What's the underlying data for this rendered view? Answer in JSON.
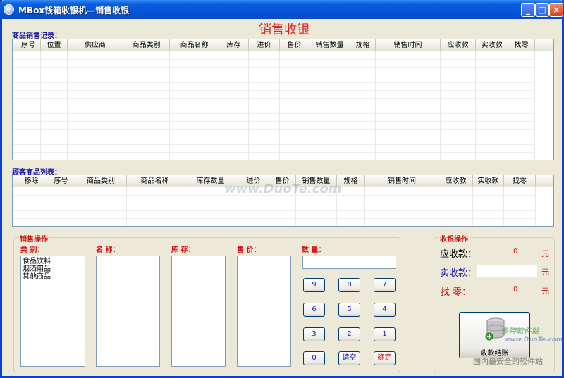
{
  "window": {
    "title": "MBox钱箱收银机—销售收银",
    "heading": "销售收银"
  },
  "sales_records": {
    "label": "商品销售记录：",
    "columns": [
      "序号",
      "位置",
      "供应商",
      "商品类别",
      "商品名称",
      "库存",
      "进价",
      "售价",
      "销售数量",
      "规格",
      "销售时间",
      "应收款",
      "实收款",
      "找零"
    ]
  },
  "customer_items": {
    "label": "顾客商品列表：",
    "columns": [
      "移除",
      "序号",
      "商品类别",
      "商品名称",
      "库存数量",
      "进价",
      "售价",
      "销售数量",
      "规格",
      "销售时间",
      "应收款",
      "实收款",
      "找零"
    ]
  },
  "sales_ops": {
    "title": "销售操作",
    "category_label": "类 别：",
    "name_label": "名 称：",
    "stock_label": "库 存：",
    "price_label": "售 价：",
    "qty_label": "数 量：",
    "categories": [
      "食品饮料",
      "烟酒用品",
      "其他商品"
    ],
    "keys": [
      "9",
      "8",
      "7",
      "6",
      "5",
      "4",
      "3",
      "2",
      "1",
      "0",
      "请空",
      "确定"
    ]
  },
  "cashier_ops": {
    "title": "收银操作",
    "receivable_label": "应收款：",
    "receivable_value": "0",
    "received_label": "实收款：",
    "change_label": "找 零：",
    "change_value": "0",
    "unit": "元",
    "settle_label": "收款结账"
  },
  "watermarks": {
    "center": "www.DuoTe.com",
    "brand": "多特软件站",
    "url": "www.DuoTe.com",
    "slogan": "国内最安全的软件站"
  },
  "colors": {
    "title_bar": "#0454d8",
    "heading_red": "#e02020",
    "section_blue": "#1a1aa8",
    "window_bg": "#ece9d8"
  }
}
